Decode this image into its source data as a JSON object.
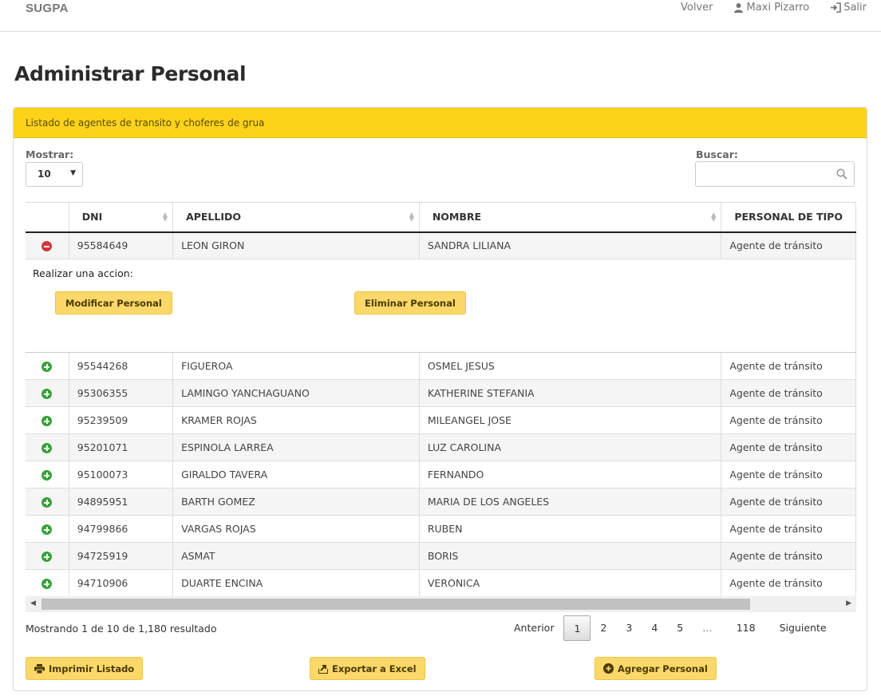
{
  "header": {
    "brand": "SUGPA",
    "nav": {
      "back": "Volver",
      "user": "Maxi Pizarro",
      "logout": "Salir"
    }
  },
  "page_title": "Administrar Personal",
  "panel": {
    "heading": "Listado de agentes de transito y choferes de grua",
    "show_label": "Mostrar:",
    "show_value": "10",
    "search_label": "Buscar:",
    "search_value": ""
  },
  "table": {
    "columns": [
      "DNI",
      "APELLIDO",
      "NOMBRE",
      "PERSONAL DE TIPO"
    ],
    "expanded_row": {
      "dni": "95584649",
      "apellido": "LEON GIRON",
      "nombre": "SANDRA LILIANA",
      "tipo": "Agente de tránsito",
      "action_title": "Realizar una accion:",
      "modify_label": "Modificar Personal",
      "delete_label": "Eliminar Personal"
    },
    "rows": [
      {
        "dni": "95544268",
        "apellido": "FIGUEROA",
        "nombre": "OSMEL JESUS",
        "tipo": "Agente de tránsito"
      },
      {
        "dni": "95306355",
        "apellido": "LAMINGO YANCHAGUANO",
        "nombre": "KATHERINE STEFANIA",
        "tipo": "Agente de tránsito"
      },
      {
        "dni": "95239509",
        "apellido": "KRAMER ROJAS",
        "nombre": "MILEANGEL JOSE",
        "tipo": "Agente de tránsito"
      },
      {
        "dni": "95201071",
        "apellido": "ESPINOLA LARREA",
        "nombre": "LUZ CAROLINA",
        "tipo": "Agente de tránsito"
      },
      {
        "dni": "95100073",
        "apellido": "GIRALDO TAVERA",
        "nombre": "FERNANDO",
        "tipo": "Agente de tránsito"
      },
      {
        "dni": "94895951",
        "apellido": "BARTH GOMEZ",
        "nombre": "MARIA DE LOS ANGELES",
        "tipo": "Agente de tránsito"
      },
      {
        "dni": "94799866",
        "apellido": "VARGAS ROJAS",
        "nombre": "RUBEN",
        "tipo": "Agente de tránsito"
      },
      {
        "dni": "94725919",
        "apellido": "ASMAT",
        "nombre": "BORIS",
        "tipo": "Agente de tránsito"
      },
      {
        "dni": "94710906",
        "apellido": "DUARTE ENCINA",
        "nombre": "VERONICA",
        "tipo": "Agente de tránsito"
      }
    ]
  },
  "footer": {
    "info": "Mostrando 1 de 10 de 1,180 resultado",
    "pagination": {
      "prev": "Anterior",
      "pages": [
        "1",
        "2",
        "3",
        "4",
        "5",
        "…",
        "118"
      ],
      "current": "1",
      "next": "Siguiente"
    },
    "buttons": {
      "print": "Imprimir Listado",
      "export": "Exportar a Excel",
      "add": "Agregar Personal"
    }
  },
  "colors": {
    "accent": "#fcd319",
    "button": "#fcd86a",
    "plus": "#37a13a",
    "minus": "#d3333a"
  }
}
